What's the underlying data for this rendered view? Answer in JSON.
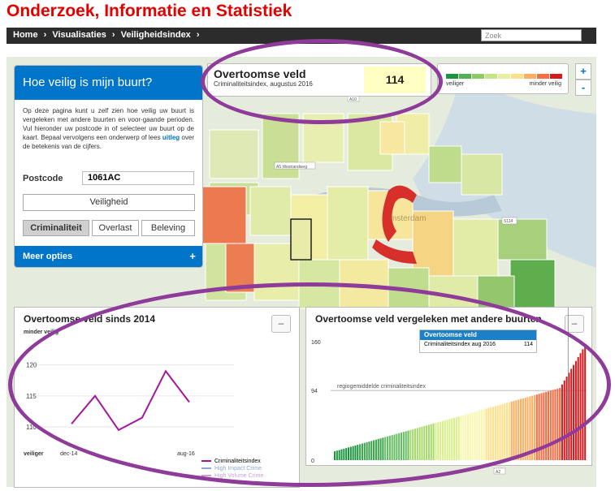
{
  "site_title": "Onderzoek, Informatie en Statistiek",
  "breadcrumb": [
    "Home",
    "Visualisaties",
    "Veiligheidsindex"
  ],
  "breadcrumb_sep": "›",
  "search_placeholder": "Zoek",
  "left_panel": {
    "heading": "Hoe veilig is mijn buurt?",
    "intro_before_link": "Op deze pagina kunt u zelf zien hoe veilig uw buurt is vergeleken met andere buurten en voor-gaande perioden. Vul hieronder uw postcode in of selecteer uw buurt op de kaart. Bepaal vervolgens een onderwerp of lees",
    "intro_link": "uitleg",
    "intro_after_link": "over de betekenis van de cijfers.",
    "postcode_label": "Postcode",
    "postcode_value": "1061AC",
    "veiligheid_button": "Veiligheid",
    "tabs": [
      "Criminaliteit",
      "Overlast",
      "Beleving"
    ],
    "more_options": "Meer opties",
    "more_options_icon": "+"
  },
  "info_box": {
    "title": "Overtoomse veld",
    "subtitle": "Criminaliteitsindex, augustus 2016",
    "value": "114"
  },
  "legend": {
    "left": "veiliger",
    "right": "minder veilig",
    "colors": [
      "#1a9641",
      "#52b151",
      "#8fcc60",
      "#c4e687",
      "#e6f0a0",
      "#fee08b",
      "#fdae61",
      "#f46d43",
      "#d7191c"
    ]
  },
  "zoom": {
    "in": "+",
    "out": "-"
  },
  "map_labels": {
    "a10": "A10",
    "a5": "A5 Westrandweg",
    "s114": "S114",
    "a2": "A2",
    "city": "msterdam"
  },
  "chart1": {
    "title": "Overtoomse veld sinds 2014",
    "top_label": "minder veilig",
    "bottom_label": "veiliger",
    "collapse": "–",
    "legend": [
      "Criminaliteitsindex",
      "High Impact Crime",
      "High Volume Crime"
    ],
    "legend_colors": [
      "#a4169b",
      "#8aa8d8",
      "#c9a0d8"
    ]
  },
  "chart2": {
    "title": "Overtoomse veld vergeleken met andere buurten",
    "collapse": "–",
    "avg_label": "regiogemiddelde criminaliteitsindex",
    "tooltip_title": "Overtoomse veld",
    "tooltip_label": "Criminaliteitsindex aug 2016",
    "tooltip_value": "114"
  },
  "chart_data": [
    {
      "type": "line",
      "title": "Overtoomse veld sinds 2014",
      "x_tick_labels": [
        "dec-14",
        "aug-16"
      ],
      "y_ticks": [
        110,
        115,
        120
      ],
      "ylim": [
        107,
        124
      ],
      "series": [
        {
          "name": "Criminaliteitsindex",
          "values": [
            110.5,
            115.0,
            109.5,
            111.5,
            119.0,
            114.0
          ]
        }
      ]
    },
    {
      "type": "bar",
      "title": "Overtoomse veld vergeleken met andere buurten",
      "y_ticks": [
        0,
        94,
        160
      ],
      "ylim": [
        0,
        160
      ],
      "average": 94,
      "highlight_value": 114,
      "n_neighbourhoods": 110
    }
  ]
}
